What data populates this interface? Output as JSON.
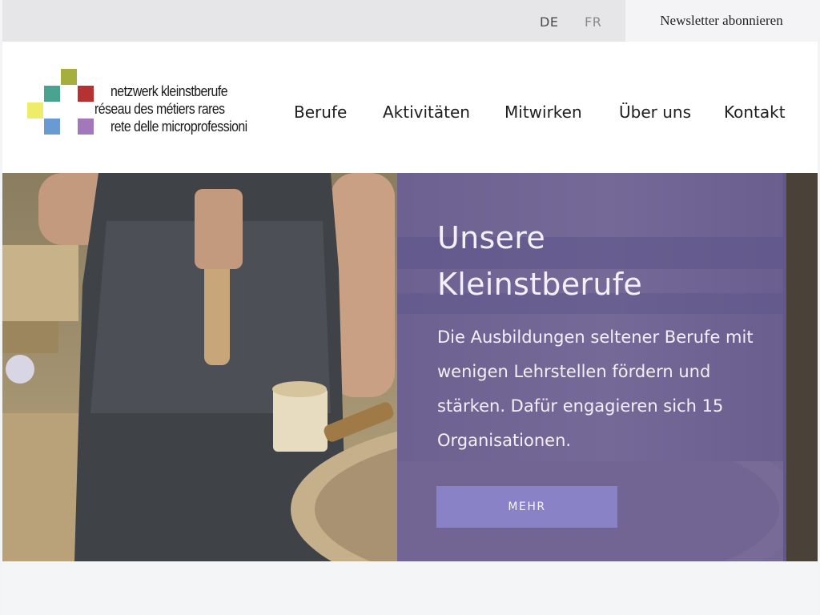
{
  "topbar": {
    "languages": [
      "DE",
      "FR"
    ],
    "newsletter_label": "Newsletter abonnieren"
  },
  "logo": {
    "lines": [
      "netzwerk kleinstberufe",
      "réseau des métiers rares",
      "rete delle microprofessioni"
    ],
    "colors": [
      "#a6ae3e",
      "#4aa38e",
      "#b43232",
      "#eded6a",
      "#6a9ad2",
      "#a278ba"
    ]
  },
  "nav": {
    "items": [
      "Berufe",
      "Aktivitäten",
      "Mitwirken",
      "Über uns",
      "Kontakt"
    ]
  },
  "hero": {
    "title_lines": [
      "Unsere",
      "Kleinstberufe"
    ],
    "text": "Die Ausbildungen seltener Berufe mit wenigen Lehrstellen fördern und stärken. Dafür engagieren sich 15 Organisationen.",
    "button_label": "MEHR",
    "overlay_color": "#665c9b"
  }
}
